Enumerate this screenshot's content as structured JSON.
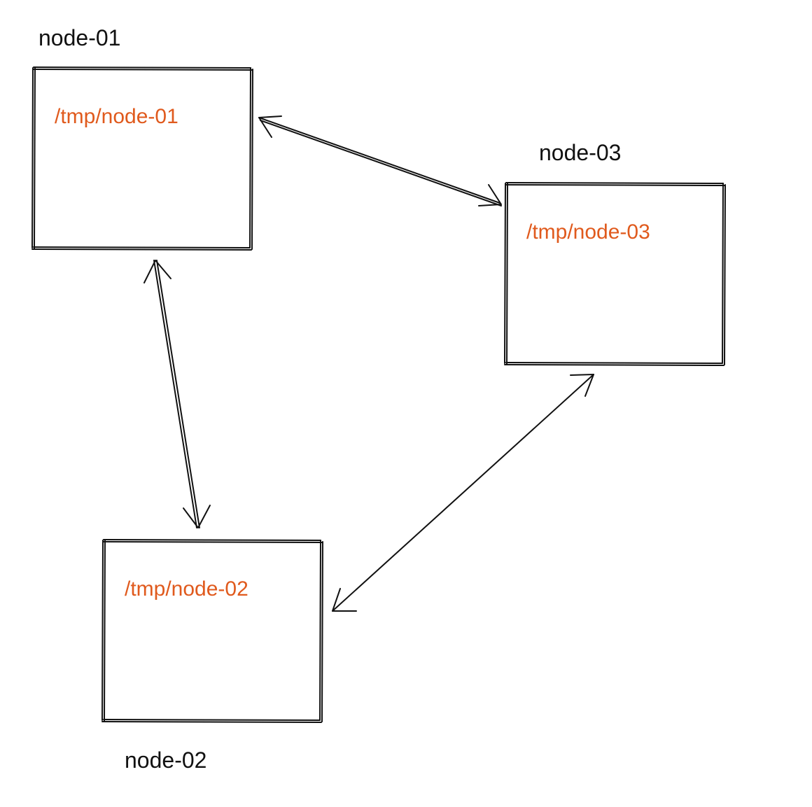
{
  "nodes": {
    "n1": {
      "label": "node-01",
      "path": "/tmp/node-01"
    },
    "n2": {
      "label": "node-02",
      "path": "/tmp/node-02"
    },
    "n3": {
      "label": "node-03",
      "path": "/tmp/node-03"
    }
  },
  "colors": {
    "path_text": "#e05a1d",
    "stroke": "#111111",
    "bg": "#ffffff"
  },
  "edges": [
    {
      "from": "node-01",
      "to": "node-03",
      "bidirectional": true
    },
    {
      "from": "node-01",
      "to": "node-02",
      "bidirectional": true
    },
    {
      "from": "node-02",
      "to": "node-03",
      "bidirectional": true
    }
  ]
}
